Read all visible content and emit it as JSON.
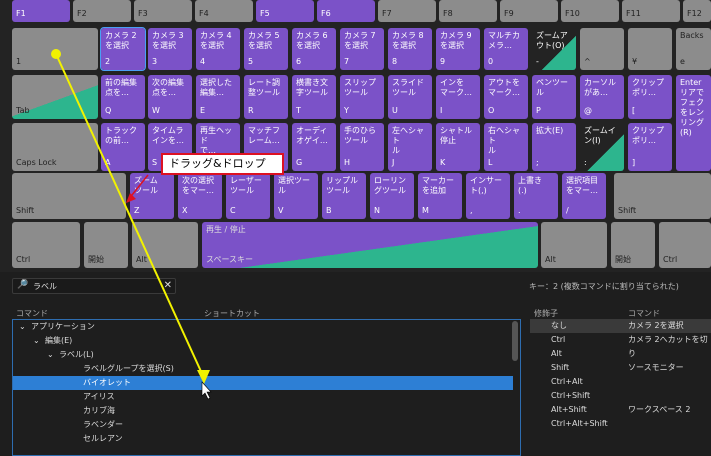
{
  "fkeys": {
    "f1": "F1",
    "f2": "F2",
    "f3": "F3",
    "f4": "F4",
    "f5": "F5",
    "f6": "F6",
    "f7": "F7",
    "f8": "F8",
    "f9": "F9",
    "f10": "F10",
    "f11": "F11",
    "f12": "F12"
  },
  "row1": [
    {
      "top": "",
      "bottom": "1"
    },
    {
      "top": "カメラ 2\nを選択",
      "bottom": "2"
    },
    {
      "top": "カメラ 3\nを選択",
      "bottom": "3"
    },
    {
      "top": "カメラ 4\nを選択",
      "bottom": "4"
    },
    {
      "top": "カメラ 5\nを選択",
      "bottom": "5"
    },
    {
      "top": "カメラ 6\nを選択",
      "bottom": "6"
    },
    {
      "top": "カメラ 7\nを選択",
      "bottom": "7"
    },
    {
      "top": "カメラ 8\nを選択",
      "bottom": "8"
    },
    {
      "top": "カメラ 9\nを選択",
      "bottom": "9"
    },
    {
      "top": "マルチカ\nメラ…",
      "bottom": "0"
    },
    {
      "top": "ズームア\nウト(O)",
      "bottom": "-"
    },
    {
      "top": "",
      "bottom": "^"
    },
    {
      "top": "",
      "bottom": "¥"
    },
    {
      "top": "Backs",
      "bottom": "e"
    }
  ],
  "row2": [
    {
      "top": "",
      "bottom": "Tab"
    },
    {
      "top": "前の編集\n点を…",
      "bottom": "Q"
    },
    {
      "top": "次の編集\n点を…",
      "bottom": "W"
    },
    {
      "top": "選択した\n編集…",
      "bottom": "E"
    },
    {
      "top": "レート調\n整ツール",
      "bottom": "R"
    },
    {
      "top": "横書き文\n字ツール",
      "bottom": "T"
    },
    {
      "top": "スリップ\nツール",
      "bottom": "Y"
    },
    {
      "top": "スライド\nツール",
      "bottom": "U"
    },
    {
      "top": "インを\nマーク…",
      "bottom": "I"
    },
    {
      "top": "アウトを\nマーク…",
      "bottom": "O"
    },
    {
      "top": "ペンツー\nル",
      "bottom": "P"
    },
    {
      "top": "カーソル\nがあ…",
      "bottom": "@"
    },
    {
      "top": "クリップ\nポリ…",
      "bottom": "["
    },
    {
      "top": "Enter\nリアで\nフェク\nをレン\nリング\n(R)",
      "bottom": ""
    }
  ],
  "row3": [
    {
      "top": "",
      "bottom": "Caps Lock"
    },
    {
      "top": "トラック\nの前…",
      "bottom": "A"
    },
    {
      "top": "タイムラ\nインを…",
      "bottom": "S"
    },
    {
      "top": "再生ヘッド\nで…",
      "bottom": "D"
    },
    {
      "top": "マッチフ\nレーム…",
      "bottom": "F"
    },
    {
      "top": "オーディ\nオゲイ…",
      "bottom": "G"
    },
    {
      "top": "手のひら\nツール",
      "bottom": "H"
    },
    {
      "top": "左へシャト\nル",
      "bottom": "J"
    },
    {
      "top": "シャトル\n停止",
      "bottom": "K"
    },
    {
      "top": "右へシャト\nル",
      "bottom": "L"
    },
    {
      "top": "拡大(E)",
      "bottom": ";"
    },
    {
      "top": "ズームイ\nン(I)",
      "bottom": ":"
    },
    {
      "top": "クリップ\nポリ…",
      "bottom": "]"
    },
    {
      "top": "",
      "bottom": "Enter"
    }
  ],
  "row4": [
    {
      "top": "",
      "bottom": "Shift"
    },
    {
      "top": "ズーム\nツール",
      "bottom": "Z"
    },
    {
      "top": "次の選択\nをマー…",
      "bottom": "X"
    },
    {
      "top": "レーザー\nツール",
      "bottom": "C"
    },
    {
      "top": "選択ツー\nル",
      "bottom": "V"
    },
    {
      "top": "リップル\nツール",
      "bottom": "B"
    },
    {
      "top": "ローリン\nグツール",
      "bottom": "N"
    },
    {
      "top": "マーカー\nを追加",
      "bottom": "M"
    },
    {
      "top": "インサー\nト(,)",
      "bottom": ","
    },
    {
      "top": "上書き\n(.)",
      "bottom": "."
    },
    {
      "top": "選択項目\nをマー…",
      "bottom": "/"
    },
    {
      "top": "",
      "bottom": "\\"
    },
    {
      "top": "",
      "bottom": "Shift"
    }
  ],
  "row5": [
    {
      "top": "",
      "bottom": "Ctrl"
    },
    {
      "top": "",
      "bottom": "開始"
    },
    {
      "top": "",
      "bottom": "Alt"
    },
    {
      "top": "再生 / 停止",
      "bottom": "スペースキー"
    },
    {
      "top": "",
      "bottom": "Alt"
    },
    {
      "top": "",
      "bottom": "開始"
    },
    {
      "top": "",
      "bottom": "Ctrl"
    }
  ],
  "search": {
    "icon": "🔎",
    "query": "ラベル",
    "clear": "✕"
  },
  "note": "キー：2 (複数コマンドに割り当てられた)",
  "headers": {
    "command": "コマンド",
    "shortcut": "ショートカット",
    "modifier": "修飾子",
    "command2": "コマンド"
  },
  "tree": [
    {
      "arrow": "⌄",
      "label": "アプリケーション",
      "level": 0
    },
    {
      "arrow": "⌄",
      "label": "編集(E)",
      "level": 1
    },
    {
      "arrow": "⌄",
      "label": "ラベル(L)",
      "level": 2
    },
    {
      "arrow": "",
      "label": "ラベルグループを選択(S)",
      "level": 3
    },
    {
      "arrow": "",
      "label": "バイオレット",
      "level": 3,
      "selected": true
    },
    {
      "arrow": "",
      "label": "アイリス",
      "level": 3
    },
    {
      "arrow": "",
      "label": "カリブ海",
      "level": 3
    },
    {
      "arrow": "",
      "label": "ラベンダー",
      "level": 3
    },
    {
      "arrow": "",
      "label": "セルレアン",
      "level": 3
    }
  ],
  "modifiers": [
    {
      "mod": "なし",
      "cmd": "カメラ 2を選択",
      "hl": true
    },
    {
      "mod": "Ctrl",
      "cmd": "カメラ 2へカットを切り"
    },
    {
      "mod": "Alt",
      "cmd": ""
    },
    {
      "mod": "Shift",
      "cmd": "ソースモニター"
    },
    {
      "mod": "Ctrl+Alt",
      "cmd": ""
    },
    {
      "mod": "Ctrl+Shift",
      "cmd": ""
    },
    {
      "mod": "Alt+Shift",
      "cmd": "ワークスペース 2"
    },
    {
      "mod": "Ctrl+Alt+Shift",
      "cmd": ""
    }
  ],
  "callout": "ドラッグ&ドロップ",
  "colors": {
    "purple": "#7b52c8",
    "green": "#2db58e",
    "gray": "#8c8c8c",
    "selection": "#2d7fd5",
    "arrow": "#f2f200"
  }
}
